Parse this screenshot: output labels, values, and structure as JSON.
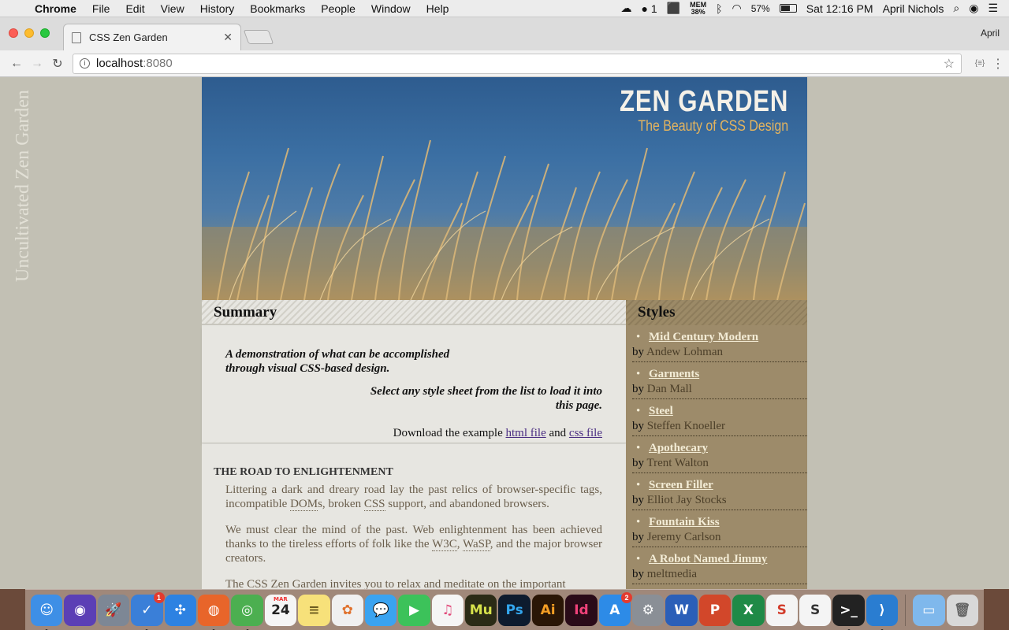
{
  "menubar": {
    "app_name": "Chrome",
    "items": [
      "File",
      "Edit",
      "View",
      "History",
      "Bookmarks",
      "People",
      "Window",
      "Help"
    ],
    "status": {
      "notification_count": "1",
      "mem_label": "MEM",
      "mem_value": "38%",
      "battery": "57%",
      "clock": "Sat 12:16 PM",
      "user": "April Nichols"
    }
  },
  "browser": {
    "tab_title": "CSS Zen Garden",
    "profile_name": "April",
    "url_host": "localhost",
    "url_port": ":8080",
    "extension_label": "{≡}"
  },
  "site": {
    "side_title": "Uncultivated Zen Garden",
    "hero_title": "ZEN GARDEN",
    "hero_subtitle": "The Beauty of CSS Design",
    "summary": {
      "heading": "Summary",
      "p1": "A demonstration of what can be accomplished through visual CSS-based design.",
      "p2": "Select any style sheet from the list to load it into this page.",
      "download_prefix": "Download the example ",
      "html_link": "html file",
      "and": " and ",
      "css_link": "css file"
    },
    "road": {
      "heading": "THE ROAD TO ENLIGHTENMENT",
      "p1_a": "Littering a dark and dreary road lay the past relics of browser-specific tags, incompatible ",
      "p1_dom": "DOM",
      "p1_b": "s, broken ",
      "p1_css": "CSS",
      "p1_c": " support, and abandoned browsers.",
      "p2_a": "We must clear the mind of the past. Web enlightenment has been achieved thanks to the tireless efforts of folk like the ",
      "p2_w3c": "W3C",
      "p2_sep": ", ",
      "p2_wasp": "WaSP",
      "p2_b": ", and the major browser creators.",
      "p3": "The CSS Zen Garden invites you to relax and meditate on the important"
    },
    "styles": {
      "heading": "Styles",
      "by": "by ",
      "items": [
        {
          "name": "Mid Century Modern",
          "author": "Andew Lohman"
        },
        {
          "name": "Garments",
          "author": "Dan Mall"
        },
        {
          "name": "Steel",
          "author": "Steffen Knoeller"
        },
        {
          "name": "Apothecary",
          "author": "Trent Walton"
        },
        {
          "name": "Screen Filler",
          "author": "Elliot Jay Stocks"
        },
        {
          "name": "Fountain Kiss",
          "author": "Jeremy Carlson"
        },
        {
          "name": "A Robot Named Jimmy",
          "author": "meltmedia"
        }
      ]
    }
  },
  "dock": {
    "icons": [
      {
        "name": "finder-icon",
        "glyph": "☺",
        "color": "#3e8fe6",
        "dot": true
      },
      {
        "name": "siri-icon",
        "glyph": "◉",
        "color": "#5b3fb5"
      },
      {
        "name": "launchpad-icon",
        "glyph": "🚀",
        "color": "#7d8795"
      },
      {
        "name": "clock-icon",
        "glyph": "✓",
        "color": "#3a7fd8",
        "badge": "1",
        "dot": true
      },
      {
        "name": "safari-icon",
        "glyph": "✣",
        "color": "#2d82e2"
      },
      {
        "name": "firefox-icon",
        "glyph": "◍",
        "color": "#e8652a",
        "dot": true
      },
      {
        "name": "chrome-icon",
        "glyph": "◎",
        "color": "#4caf50",
        "dot": true
      },
      {
        "name": "calendar-icon",
        "glyph": "24",
        "color": "#f5f5f5",
        "text": "#222",
        "label": "MAR"
      },
      {
        "name": "notes-icon",
        "glyph": "≡",
        "color": "#f7e17a",
        "text": "#6b5a1e"
      },
      {
        "name": "photos-icon",
        "glyph": "✿",
        "color": "#f0f0f0",
        "text": "#e0722e"
      },
      {
        "name": "messages-icon",
        "glyph": "💬",
        "color": "#3aa3f0"
      },
      {
        "name": "facetime-icon",
        "glyph": "▶",
        "color": "#3cc25a"
      },
      {
        "name": "itunes-icon",
        "glyph": "♫",
        "color": "#f5f5f5",
        "text": "#e14a7a"
      },
      {
        "name": "muse-icon",
        "glyph": "Mu",
        "color": "#2b2b16",
        "text": "#d7e24b"
      },
      {
        "name": "photoshop-icon",
        "glyph": "Ps",
        "color": "#0d1b2e",
        "text": "#33a7f0"
      },
      {
        "name": "illustrator-icon",
        "glyph": "Ai",
        "color": "#2a1606",
        "text": "#f59e24"
      },
      {
        "name": "indesign-icon",
        "glyph": "Id",
        "color": "#2a0b18",
        "text": "#f0427a"
      },
      {
        "name": "app-store-icon",
        "glyph": "A",
        "color": "#2d8be7",
        "badge": "2"
      },
      {
        "name": "system-preferences-icon",
        "glyph": "⚙",
        "color": "#8a8f96"
      },
      {
        "name": "word-icon",
        "glyph": "W",
        "color": "#2b5fb8"
      },
      {
        "name": "powerpoint-icon",
        "glyph": "P",
        "color": "#d2472a"
      },
      {
        "name": "excel-icon",
        "glyph": "X",
        "color": "#1f8a47"
      },
      {
        "name": "scrivener-icon",
        "glyph": "S",
        "color": "#f4f4f4",
        "text": "#d23b2a"
      },
      {
        "name": "sublime-icon",
        "glyph": "S",
        "color": "#f4f4f4",
        "text": "#333"
      },
      {
        "name": "terminal-icon",
        "glyph": ">_",
        "color": "#222",
        "dot": true
      },
      {
        "name": "vscode-icon",
        "glyph": "⟩",
        "color": "#2a7dd1",
        "dot": true
      },
      {
        "name": "folder-icon",
        "glyph": "▭",
        "color": "#7fb8ec",
        "sep_before": true
      },
      {
        "name": "trash-icon",
        "glyph": "🗑",
        "color": "#d8d8d8",
        "text": "#666"
      }
    ]
  }
}
